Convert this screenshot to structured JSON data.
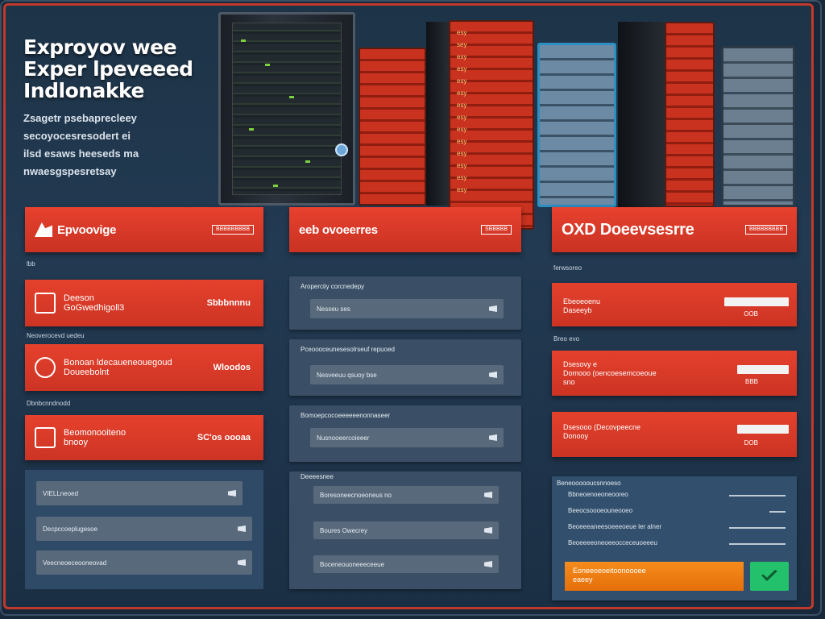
{
  "hero": {
    "title": "Exproyov wee\nExper lpeveeed\nIndlonakke",
    "subtitle": "Zsagetr psebaprecleey\nsecoyocesresodert ei\nilsd esaws heeseds ma\nnwaesgspesretsay"
  },
  "colors": {
    "accent": "#e2402d",
    "panel": "#2f4a66",
    "card": "#3a4f66",
    "orange": "#f28a1a",
    "green": "#23c16b"
  },
  "rack_labels": "esy\nsey\nexy\nesy\nesy\nesy\nesy\nesy\nesy\nesy\nesy\nesy\nesy\nesy",
  "left": {
    "header": "Epvoovige",
    "badge": "BBBBBBBBB",
    "label_top": "lbb",
    "card1": {
      "icon": "briefcase-icon",
      "text": "Deeson\nGoGwedhigoll3",
      "value": "Sbbbnnnu"
    },
    "label_mid": "Neoverocevd uedeu",
    "card2": {
      "icon": "lock-icon",
      "text": "Bonoan ldecaueneouegoud\nDoueebolnt",
      "value": "Wloodos"
    },
    "label_low": "Dbnbcnndnodd",
    "card3": {
      "icon": "document-icon",
      "text": "Beomonooiteno\nbnooy",
      "value": "SC'os oooaa"
    },
    "fields": [
      "VIELLneoed",
      "Decpccoeplugesoe",
      "Veecneoeceooneovad"
    ]
  },
  "middle": {
    "header": "eeb ovoeerres",
    "badge": "SBBBBB",
    "groups": [
      {
        "caption": "Aroperciiy corcnedepy",
        "field": "Nesseu ses"
      },
      {
        "caption": "Pceoooceunesesolrseuf repuoed",
        "field": "Nesveeuu qsuoy bse"
      },
      {
        "caption": "Bomoepcocoeeeeeenonnaseer",
        "field": "Nusnooeercoieeer"
      }
    ],
    "list_caption": "Deeeesnee",
    "list": [
      "Boresoneecnoeoneus no",
      "Boures Owecrey",
      "Boceneouoneeeceeue"
    ]
  },
  "right": {
    "header": "OXD Doeevsesrre",
    "badge": "BBBBBBBBB",
    "cards": [
      {
        "text": "Ebeoeoenu\nDaseeyb",
        "count": "OOB"
      },
      {
        "text": "Dsesovy e\nDomooo (oencoesemcoeoue\nsno",
        "count": "BBB"
      },
      {
        "text": "Dsesooo (Decovpeecne\nDonooy",
        "count": "DOB"
      }
    ],
    "label_mid": "Breo evo",
    "label_top": "ferwsoreo",
    "summary_title": "Beneoooooucsnnoeso",
    "summary_rows": [
      "Bbneoenoeoneooreo",
      "Beeocsoooeouneooeo",
      "Beoeeeaneesoeeeoeue ler alner",
      "Beoeeeeoneoeeocceceuoeeeu"
    ],
    "btn_orange": "Eoneeoeoeitoonoooee\neaeey",
    "btn_green_icon": "check-icon"
  }
}
